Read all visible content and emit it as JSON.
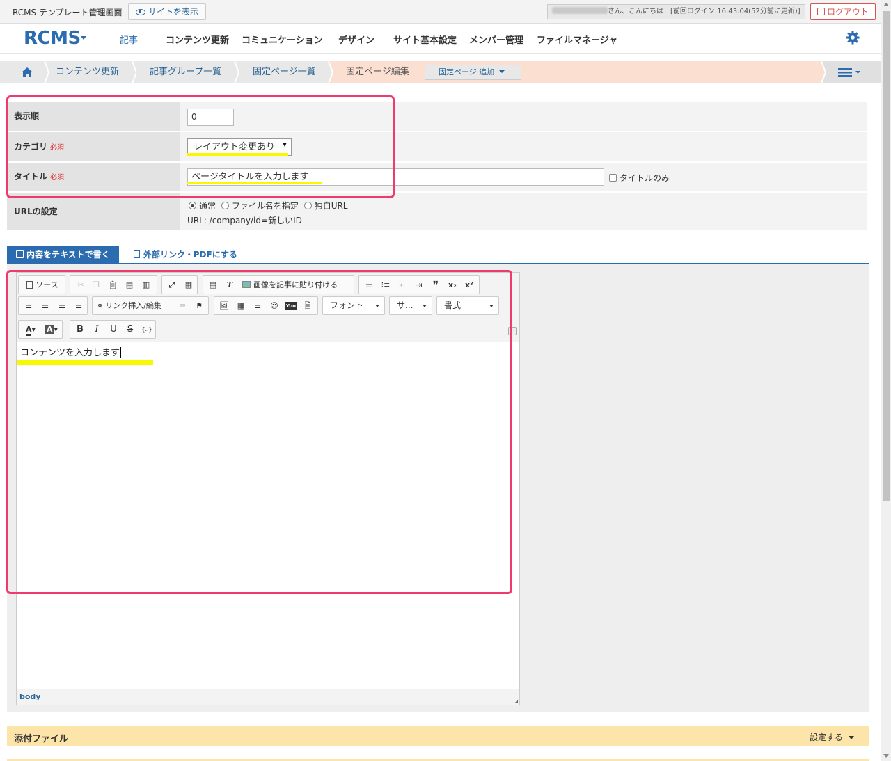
{
  "topbar": {
    "app_title": "RCMS テンプレート管理画面",
    "view_site": "サイトを表示",
    "greeting": "さん、こんにちは！[前回ログイン:16:43:04(52分前に更新)]",
    "logout": "ログアウト"
  },
  "nav": {
    "logo": "RCMS",
    "items": [
      "記事",
      "コンテンツ更新",
      "コミュニケーション",
      "デザイン",
      "サイト基本設定",
      "メンバー管理",
      "ファイルマネージャ"
    ]
  },
  "breadcrumb": {
    "items": [
      "コンテンツ更新",
      "記事グループ一覧",
      "固定ページ一覧",
      "固定ページ編集"
    ],
    "add_button": "固定ページ 追加"
  },
  "form": {
    "order_label": "表示順",
    "order_value": "0",
    "category_label": "カテゴリ",
    "category_value": "レイアウト変更あり",
    "title_label": "タイトル",
    "title_value": "ページタイトルを入力します",
    "title_only": "タイトルのみ",
    "required": "必須",
    "url_label": "URLの設定",
    "url_options": [
      "通常",
      "ファイル名を指定",
      "独自URL"
    ],
    "url_selected": "通常",
    "url_text": "URL: /company/id=新しいID"
  },
  "tabs": {
    "text": "内容をテキストで書く",
    "link": "外部リンク・PDFにする"
  },
  "editor": {
    "source": "ソース",
    "paste_image": "画像を記事に貼り付ける",
    "link_insert": "リンク挿入/編集",
    "font": "フォント",
    "size": "サ...",
    "format": "書式",
    "content": "コンテンツを入力します",
    "path": "body"
  },
  "attachments": {
    "title": "添付ファイル",
    "set": "設定する"
  },
  "colors": {
    "brand": "#2b6cb0",
    "annotation": "#ef3a6e",
    "highlight": "#f8f800",
    "required": "#e03131"
  }
}
